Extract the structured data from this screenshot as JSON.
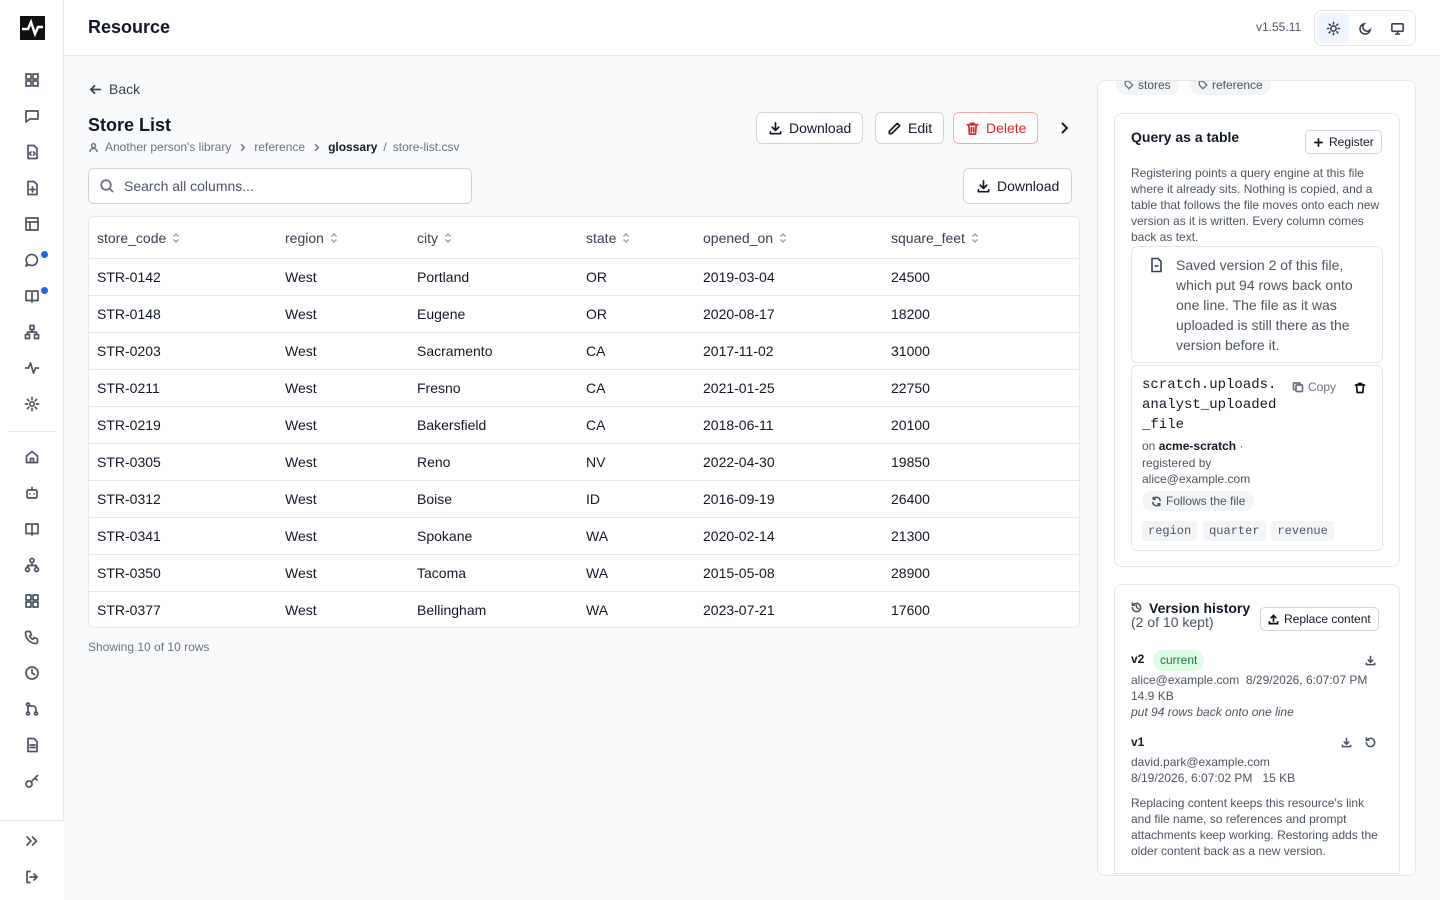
{
  "header": {
    "title": "Resource",
    "version": "v1.55.11"
  },
  "sidebar": {
    "icons": [
      "grid-icon",
      "chat-icon",
      "code-file-icon",
      "file-plus-icon",
      "table-icon",
      "chat-bubble-icon",
      "book-open-icon",
      "hierarchy-icon",
      "activity-icon",
      "settings-icon",
      "home-icon",
      "robot-icon",
      "book-icon",
      "org-chart-icon",
      "apps-icon",
      "phone-icon",
      "clock-icon",
      "branch-icon",
      "document-icon",
      "key-icon"
    ],
    "bottom": [
      "expand-icon",
      "logout-icon"
    ]
  },
  "page": {
    "back": "Back",
    "title": "Store List",
    "crumbs": {
      "library": "Another person's library",
      "folder": "reference",
      "current": "glossary",
      "file": "store-list.csv"
    },
    "actions": {
      "download": "Download",
      "edit": "Edit",
      "delete": "Delete"
    }
  },
  "search": {
    "placeholder": "Search all columns..."
  },
  "table": {
    "download": "Download",
    "columns": [
      "store_code",
      "region",
      "city",
      "state",
      "opened_on",
      "square_feet"
    ],
    "rows": [
      [
        "STR-0142",
        "West",
        "Portland",
        "OR",
        "2019-03-04",
        "24500"
      ],
      [
        "STR-0148",
        "West",
        "Eugene",
        "OR",
        "2020-08-17",
        "18200"
      ],
      [
        "STR-0203",
        "West",
        "Sacramento",
        "CA",
        "2017-11-02",
        "31000"
      ],
      [
        "STR-0211",
        "West",
        "Fresno",
        "CA",
        "2021-01-25",
        "22750"
      ],
      [
        "STR-0219",
        "West",
        "Bakersfield",
        "CA",
        "2018-06-11",
        "20100"
      ],
      [
        "STR-0305",
        "West",
        "Reno",
        "NV",
        "2022-04-30",
        "19850"
      ],
      [
        "STR-0312",
        "West",
        "Boise",
        "ID",
        "2016-09-19",
        "26400"
      ],
      [
        "STR-0341",
        "West",
        "Spokane",
        "WA",
        "2020-02-14",
        "21300"
      ],
      [
        "STR-0350",
        "West",
        "Tacoma",
        "WA",
        "2015-05-08",
        "28900"
      ],
      [
        "STR-0377",
        "West",
        "Bellingham",
        "WA",
        "2023-07-21",
        "17600"
      ]
    ],
    "footer": "Showing 10 of 10 rows"
  },
  "panel": {
    "tags": [
      "stores",
      "reference"
    ],
    "query": {
      "title": "Query as a table",
      "register": "Register",
      "description": "Registering points a query engine at this file where it already sits. Nothing is copied, and a table that follows the file moves onto each new version as it is written. Every column comes back as text.",
      "notice": "Saved version 2 of this file, which put 94 rows back onto one line. The file as it was uploaded is still there as the version before it.",
      "table_name": "scratch.uploads.analyst_uploaded_file",
      "copy": "Copy",
      "on_label": "on",
      "workspace": "acme-scratch",
      "registered_by": "registered by alice@example.com",
      "follows": "Follows the file",
      "columns": [
        "region",
        "quarter",
        "revenue"
      ]
    },
    "history": {
      "title": "Version history",
      "count": "(2 of 10 kept)",
      "replace": "Replace content",
      "versions": [
        {
          "label": "v2",
          "badge": "current",
          "user": "alice@example.com",
          "date": "8/29/2026, 6:07:07 PM",
          "size": "14.9 KB",
          "note": "put 94 rows back onto one line"
        },
        {
          "label": "v1",
          "user": "david.park@example.com",
          "date": "8/19/2026, 6:07:02 PM",
          "size": "15 KB"
        }
      ],
      "footnote": "Replacing content keeps this resource's link and file name, so references and prompt attachments keep working. Restoring adds the older content back as a new version."
    }
  }
}
